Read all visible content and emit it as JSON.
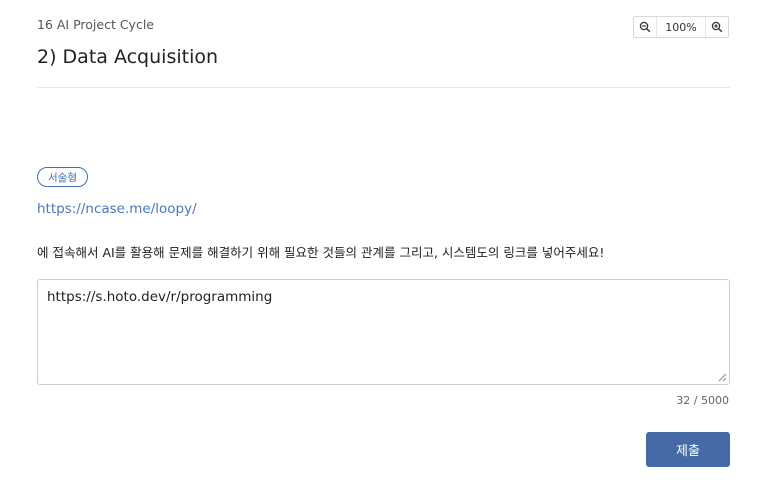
{
  "header": {
    "breadcrumb": "16 AI Project Cycle",
    "title": "2) Data Acquisition"
  },
  "zoom": {
    "level": "100%",
    "zoom_out_icon": "zoom-out-icon",
    "zoom_in_icon": "zoom-in-icon"
  },
  "question": {
    "type_badge": "서술형",
    "link_text": "https://ncase.me/loopy/",
    "prompt": "에 접속해서 AI를 활용해 문제를 해결하기 위해 필요한 것들의 관계를 그리고, 시스템도의 링크를 넣어주세요!"
  },
  "answer": {
    "value": "https://s.hoto.dev/r/programming",
    "char_count": "32 / 5000"
  },
  "actions": {
    "submit_label": "제출"
  },
  "colors": {
    "accent": "#456aa5",
    "link": "#4a78c0",
    "badge": "#3f6fb2"
  }
}
